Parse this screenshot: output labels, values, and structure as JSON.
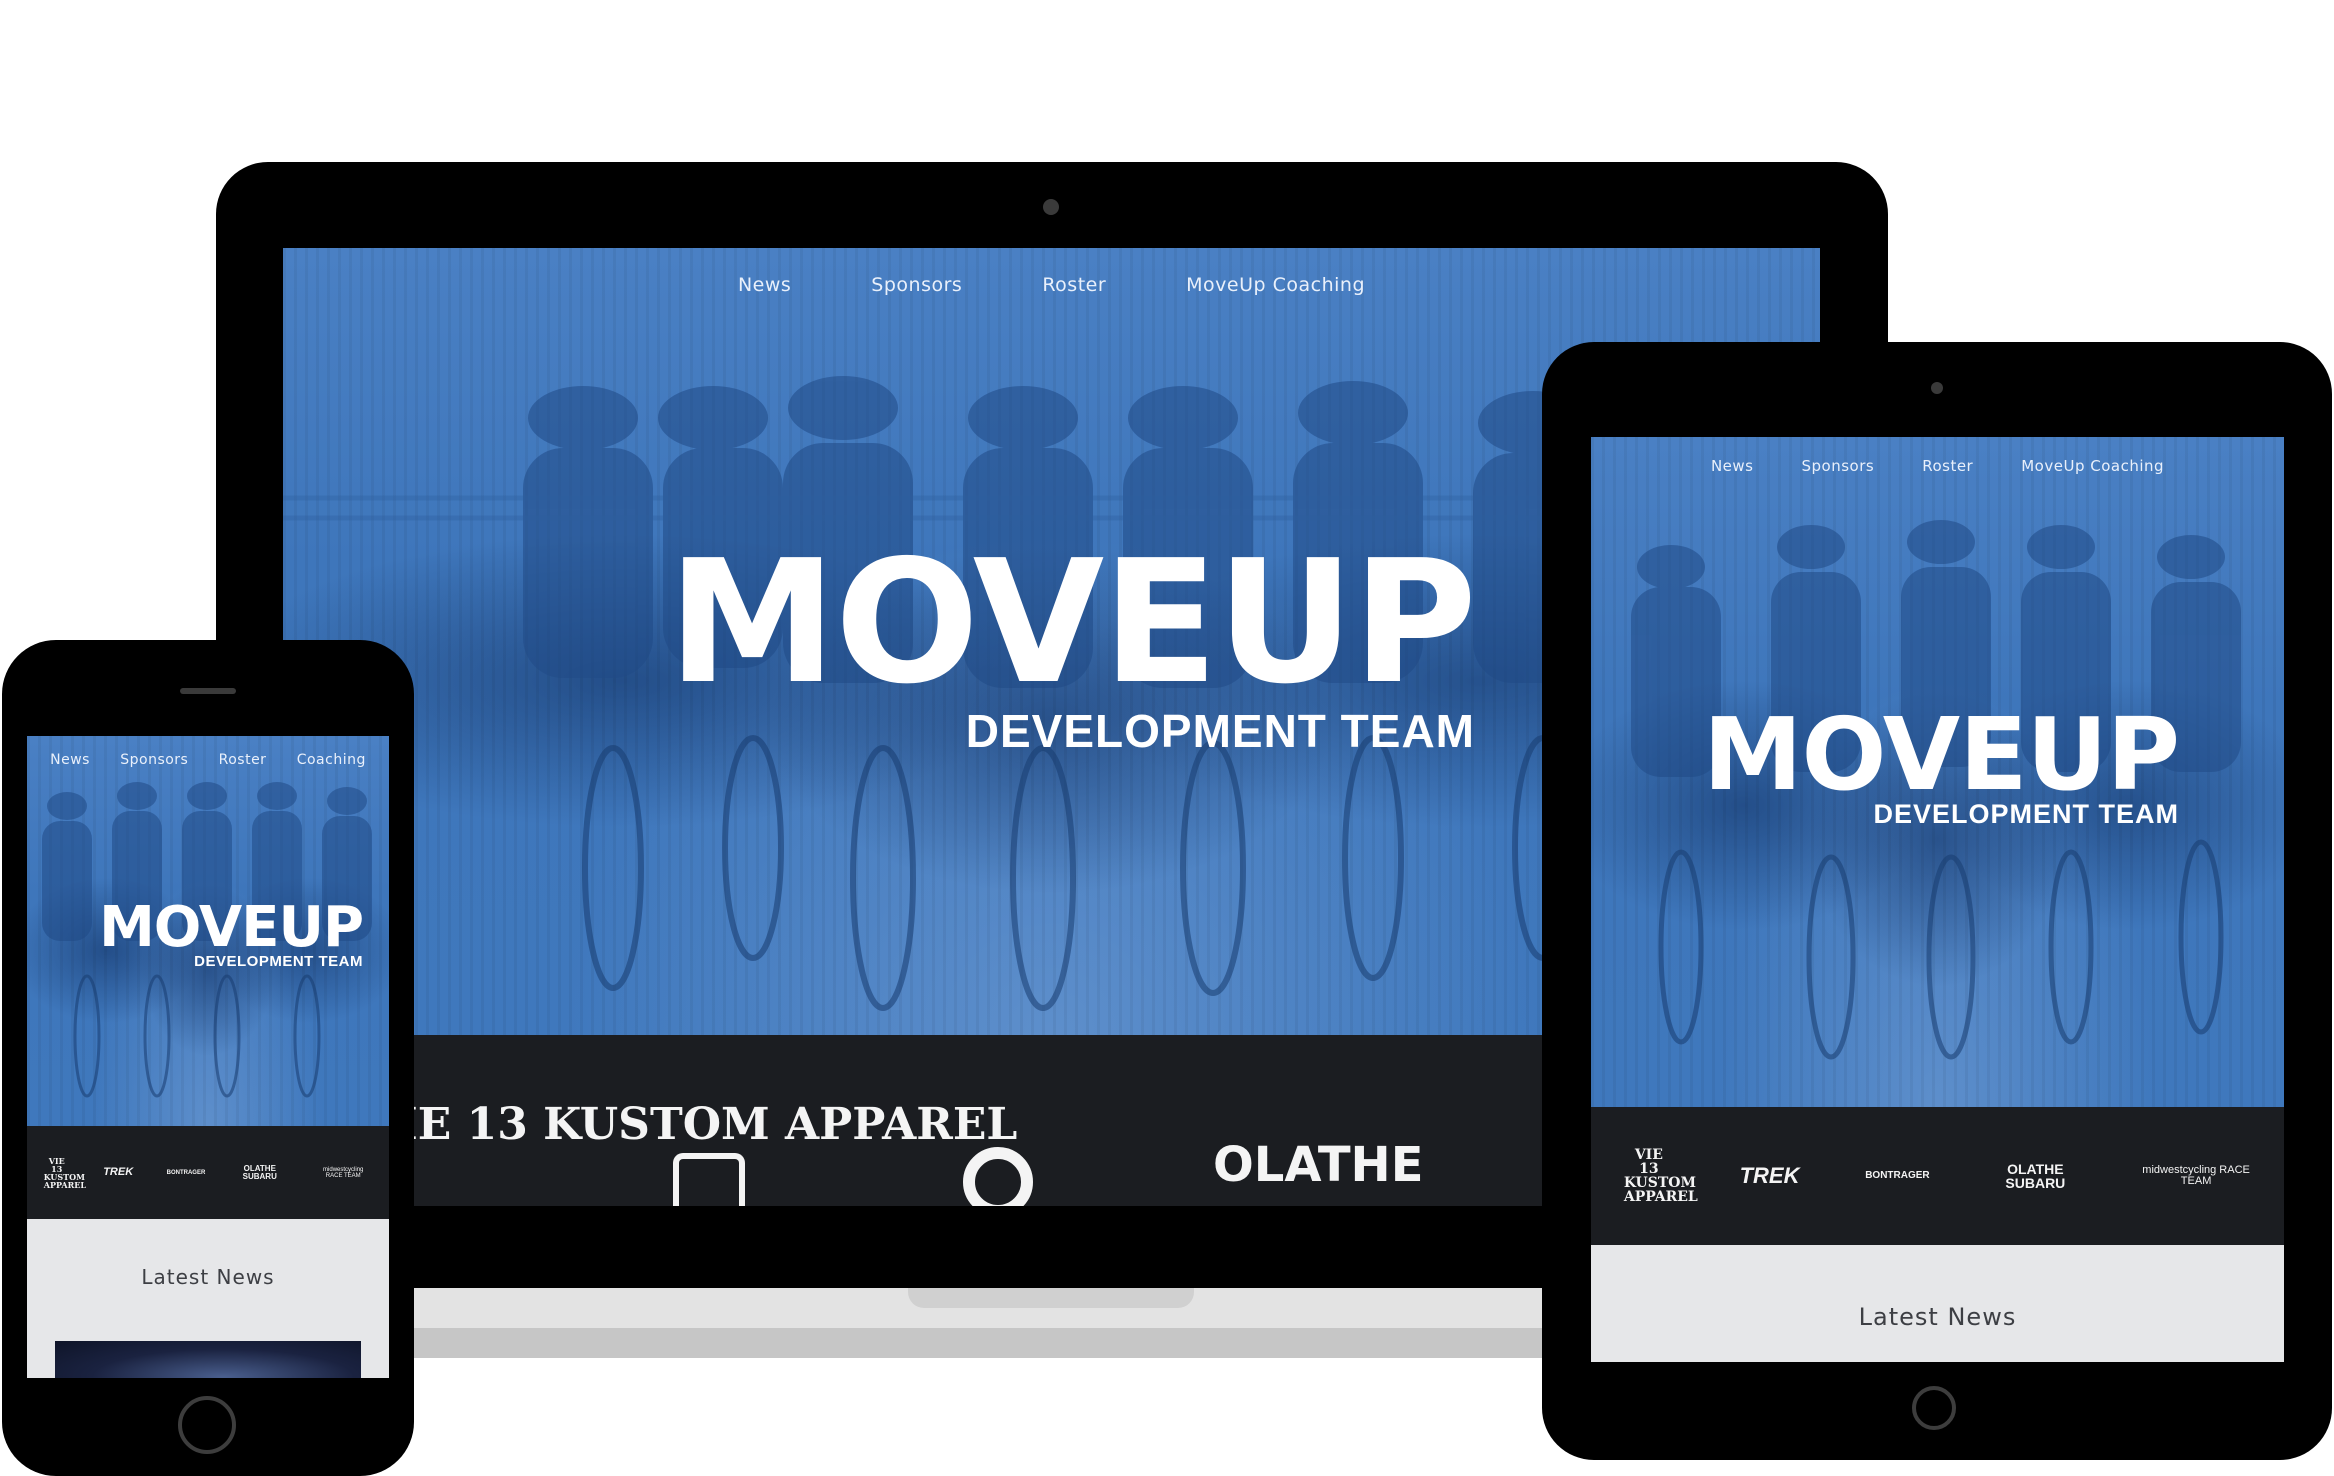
{
  "nav": {
    "items": [
      "News",
      "Sponsors",
      "Roster",
      "MoveUp Coaching"
    ]
  },
  "mobile_nav": {
    "items": [
      "News",
      "Sponsors",
      "Roster",
      "Coaching"
    ]
  },
  "hero": {
    "title": "MOVEUP",
    "subtitle": "DEVELOPMENT TEAM"
  },
  "sponsors": {
    "vie13": "VIE 13 KUSTOM APPAREL",
    "trek": "TREK",
    "bontrager": "BONTRAGER",
    "olathe": "OLATHE SUBARU",
    "midwest": "midwestcycling RACE TEAM"
  },
  "news": {
    "heading": "Latest News"
  },
  "colors": {
    "brand_blue": "#3f78bd",
    "dark_band": "#1b1d21",
    "news_bg": "#e6e7e9"
  }
}
